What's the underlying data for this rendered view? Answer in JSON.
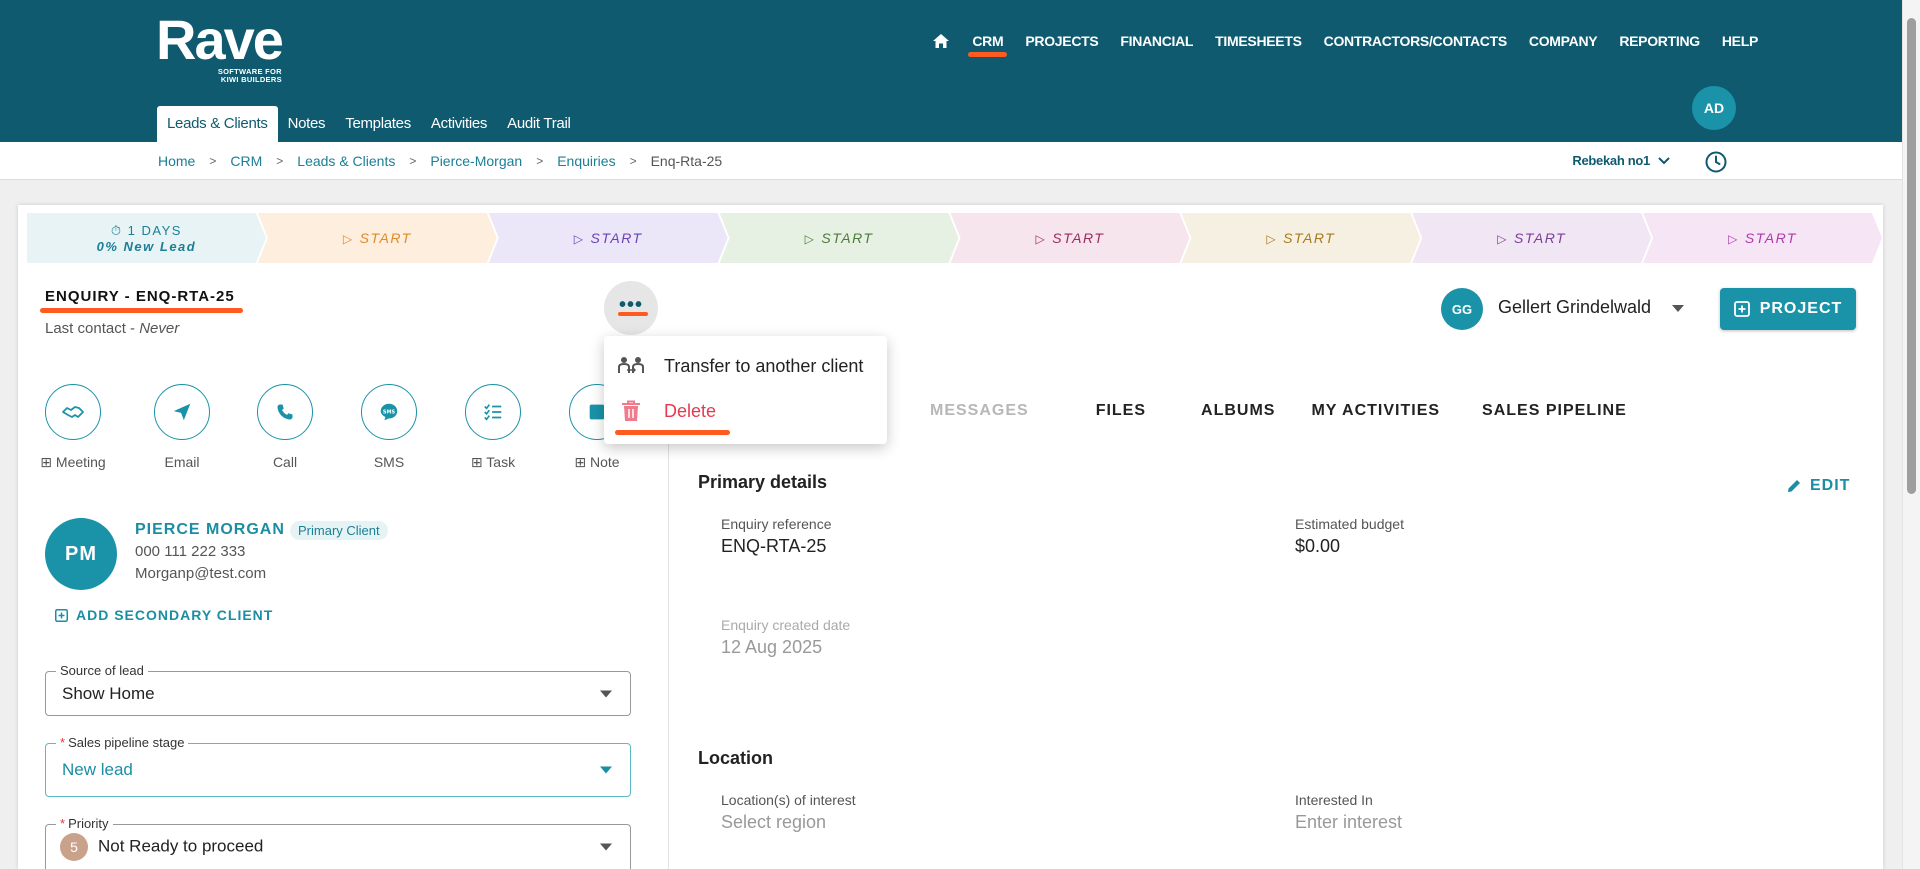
{
  "logo": {
    "brand": "Rave",
    "tagline_1": "SOFTWARE FOR",
    "tagline_2": "KIWI BUILDERS"
  },
  "topnav": {
    "items": [
      "CRM",
      "PROJECTS",
      "FINANCIAL",
      "TIMESHEETS",
      "CONTRACTORS/CONTACTS",
      "COMPANY",
      "REPORTING",
      "HELP"
    ],
    "active": "CRM"
  },
  "user_avatar": "AD",
  "subtabs": [
    "Leads & Clients",
    "Notes",
    "Templates",
    "Activities",
    "Audit Trail"
  ],
  "breadcrumb": [
    "Home",
    "CRM",
    "Leads & Clients",
    "Pierce-Morgan",
    "Enquiries",
    "Enq-Rta-25"
  ],
  "user_selector": "Rebekah no1",
  "stages": [
    {
      "line1": "1 DAYS",
      "line2": "0% New Lead",
      "bg": "#e8f3f5",
      "fg": "#1b7f95"
    },
    {
      "label": "START",
      "bg": "#fdeedd",
      "fg": "#e08a2a"
    },
    {
      "label": "START",
      "bg": "#ece7f8",
      "fg": "#6a3fb8"
    },
    {
      "label": "START",
      "bg": "#e6f1e3",
      "fg": "#4d7a3a"
    },
    {
      "label": "START",
      "bg": "#f6e5ec",
      "fg": "#9c2a5e"
    },
    {
      "label": "START",
      "bg": "#f6f0e2",
      "fg": "#a67a1f"
    },
    {
      "label": "START",
      "bg": "#f1e6f4",
      "fg": "#7a3f95"
    },
    {
      "label": "START",
      "bg": "#f6e5f5",
      "fg": "#b03aa8"
    }
  ],
  "enquiry": {
    "title": "ENQUIRY - ENQ-RTA-25",
    "last_contact_label": "Last contact - ",
    "last_contact_value": "Never"
  },
  "more_button": "•••",
  "menu": {
    "transfer": "Transfer to another client",
    "delete": "Delete"
  },
  "actions": [
    {
      "label": "Meeting",
      "plus": true
    },
    {
      "label": "Email",
      "plus": false
    },
    {
      "label": "Call",
      "plus": false
    },
    {
      "label": "SMS",
      "plus": false
    },
    {
      "label": "Task",
      "plus": true
    },
    {
      "label": "Note",
      "plus": true
    }
  ],
  "client": {
    "initials": "PM",
    "name": "PIERCE MORGAN",
    "badge": "Primary Client",
    "phone": "000 111 222 333",
    "email": "Morganp@test.com",
    "add_secondary": "ADD SECONDARY CLIENT"
  },
  "fields": {
    "source_label": "Source of lead",
    "source_value": "Show Home",
    "stage_label": "Sales pipeline stage",
    "stage_value": "New lead",
    "priority_label": "Priority",
    "priority_num": "5",
    "priority_value": "Not Ready to proceed"
  },
  "owner": {
    "initials": "GG",
    "name": "Gellert Grindelwald"
  },
  "project_button": "PROJECT",
  "tabs": [
    {
      "label": "MESSAGES",
      "disabled": true
    },
    {
      "label": "FILES",
      "disabled": false
    },
    {
      "label": "ALBUMS",
      "disabled": false
    },
    {
      "label": "MY ACTIVITIES",
      "disabled": false
    },
    {
      "label": "SALES PIPELINE",
      "disabled": false
    }
  ],
  "primary_details": {
    "title": "Primary details",
    "edit": "EDIT",
    "ref_label": "Enquiry reference",
    "ref_value": "ENQ-RTA-25",
    "budget_label": "Estimated budget",
    "budget_value": "$0.00",
    "created_label": "Enquiry created date",
    "created_value": "12 Aug 2025"
  },
  "location": {
    "title": "Location",
    "loc_label": "Location(s) of interest",
    "loc_placeholder": "Select region",
    "interest_label": "Interested In",
    "interest_placeholder": "Enter interest"
  },
  "colors": {
    "header": "#0f5a6f",
    "accent": "#1a93a8",
    "highlight": "#ff5a1f",
    "danger": "#e53950"
  }
}
